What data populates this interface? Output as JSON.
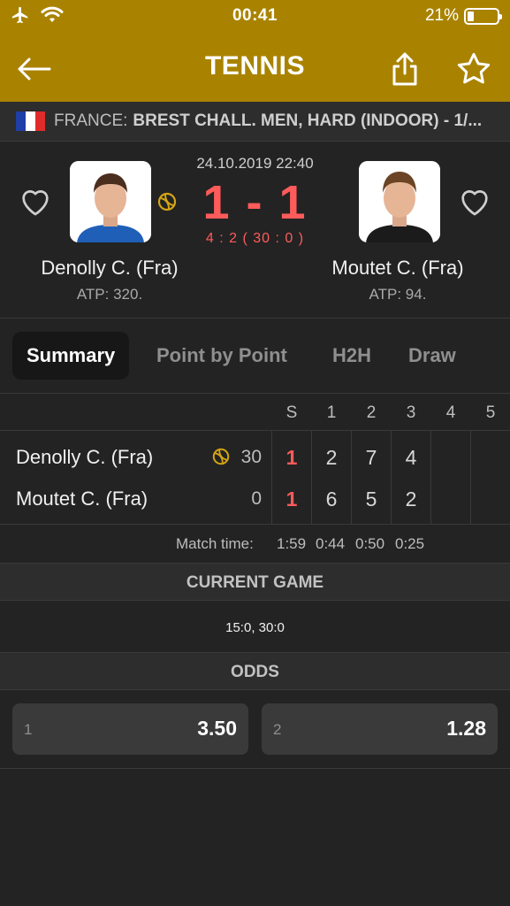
{
  "status_bar": {
    "time": "00:41",
    "battery_percent": "21%",
    "battery_level": 0.21,
    "icons": [
      "airplane-icon",
      "wifi-icon",
      "battery-icon"
    ]
  },
  "header": {
    "title": "TENNIS",
    "icons": [
      "back-arrow-icon",
      "share-icon",
      "star-icon"
    ]
  },
  "breadcrumb": {
    "country": "FRANCE:",
    "tournament": "BREST CHALL. MEN, HARD (INDOOR) - 1/...",
    "flag_colors": [
      "#1f3fa6",
      "#ffffff",
      "#e02b2b"
    ]
  },
  "match": {
    "datetime": "24.10.2019 22:40",
    "score": "1 - 1",
    "subscore": "4 : 2 ( 30 : 0 )",
    "home": {
      "name": "Denolly C. (Fra)",
      "rank": "ATP: 320."
    },
    "away": {
      "name": "Moutet C. (Fra)",
      "rank": "ATP: 94."
    }
  },
  "tabs": [
    {
      "label": "Summary",
      "active": true
    },
    {
      "label": "Point by Point",
      "active": false
    },
    {
      "label": "H2H",
      "active": false
    },
    {
      "label": "Draw",
      "active": false
    }
  ],
  "scoreboard": {
    "columns": [
      "S",
      "1",
      "2",
      "3",
      "4",
      "5"
    ],
    "rows": [
      {
        "name": "Denolly C. (Fra)",
        "points": "30",
        "serving": true,
        "sets": "1",
        "games": [
          "2",
          "7",
          "4",
          "",
          ""
        ]
      },
      {
        "name": "Moutet C. (Fra)",
        "points": "0",
        "serving": false,
        "sets": "1",
        "games": [
          "6",
          "5",
          "2",
          "",
          ""
        ]
      }
    ],
    "match_time_label": "Match time:",
    "match_times": [
      "1:59",
      "0:44",
      "0:50",
      "0:25"
    ]
  },
  "current_game": {
    "title": "CURRENT GAME",
    "value": "15:0, 30:0"
  },
  "odds": {
    "title": "ODDS",
    "items": [
      {
        "label": "1",
        "value": "3.50"
      },
      {
        "label": "2",
        "value": "1.28"
      }
    ]
  },
  "colors": {
    "header_bg": "#a98300",
    "accent_score": "#ff5b5b",
    "serve_ball": "#d4a514",
    "page_bg": "#232323"
  }
}
